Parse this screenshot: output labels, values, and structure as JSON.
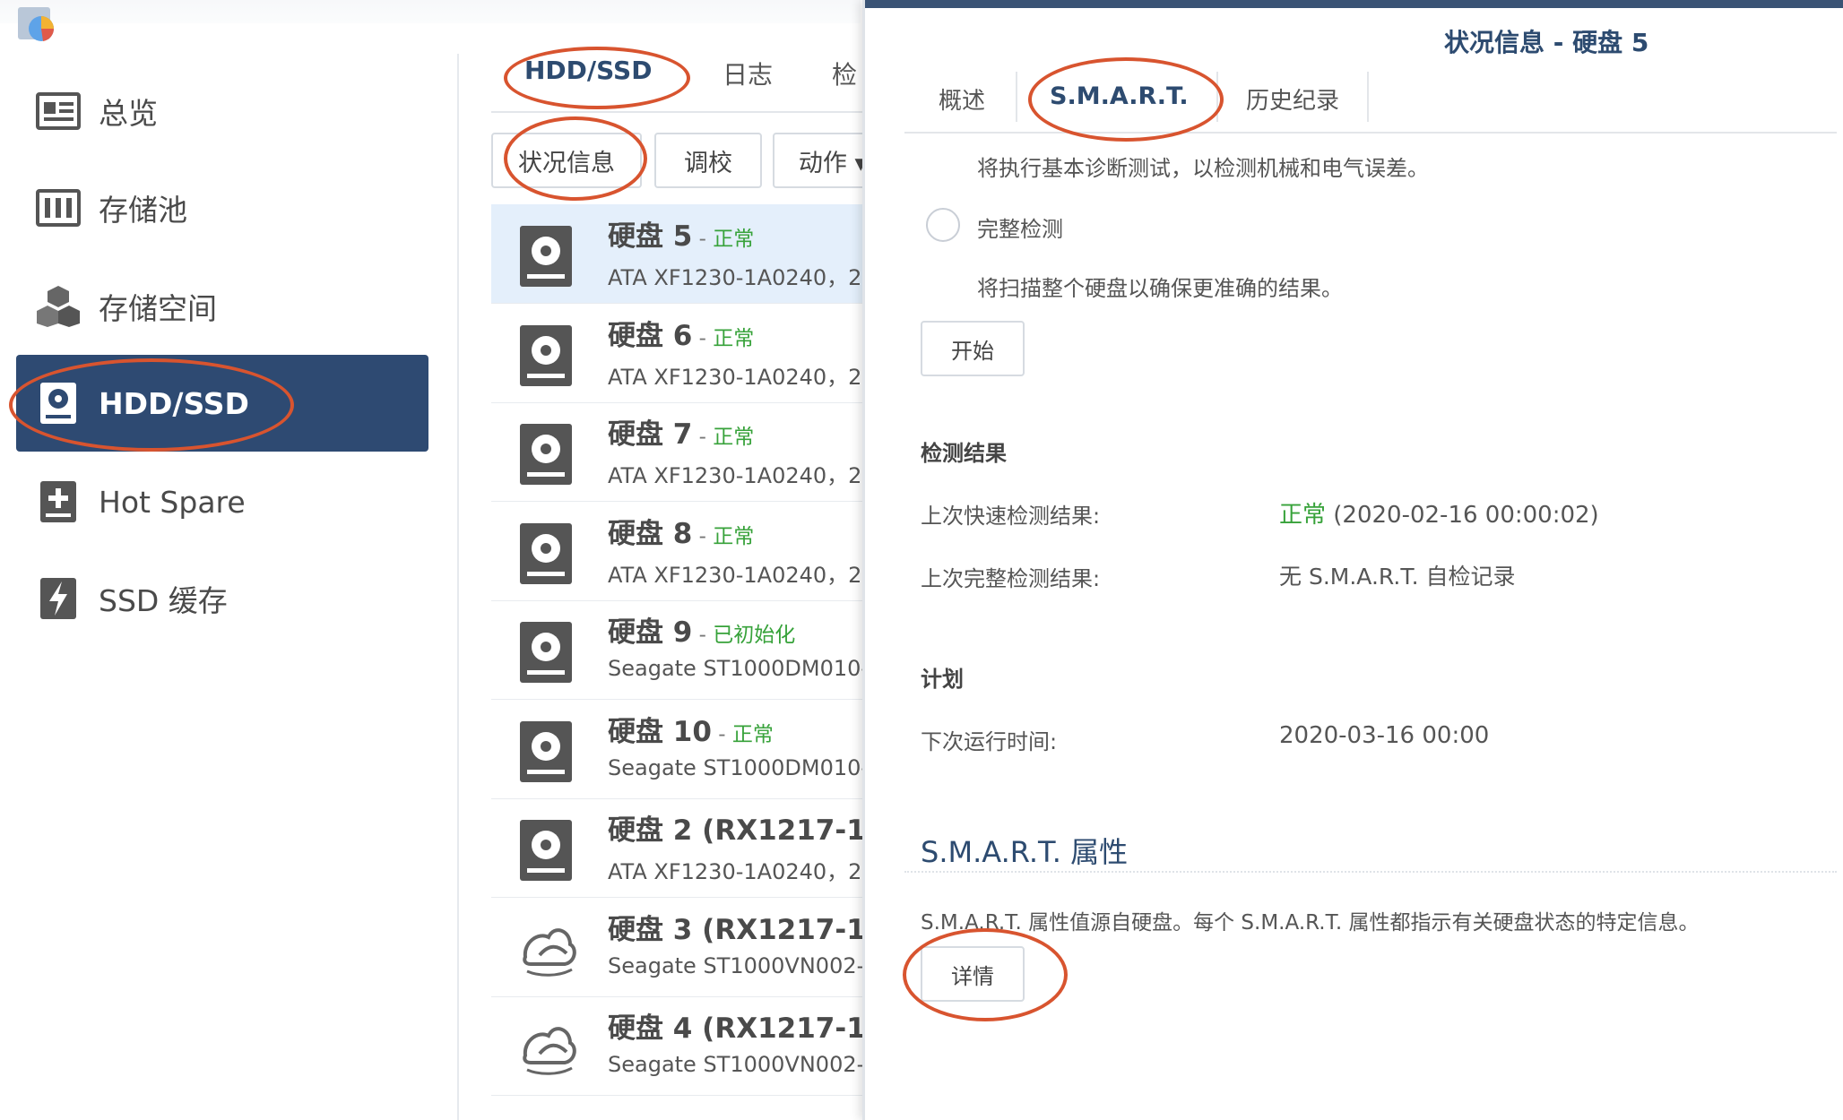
{
  "sidebar": {
    "items": [
      {
        "label": "总览",
        "icon": "overview-icon"
      },
      {
        "label": "存储池",
        "icon": "storage-pool-icon"
      },
      {
        "label": "存储空间",
        "icon": "volume-icon"
      },
      {
        "label": "HDD/SSD",
        "icon": "hdd-icon",
        "active": true
      },
      {
        "label": "Hot Spare",
        "icon": "hot-spare-icon"
      },
      {
        "label": "SSD 缓存",
        "icon": "ssd-cache-icon"
      }
    ]
  },
  "middle": {
    "tabs": [
      "HDD/SSD",
      "日志",
      "检"
    ],
    "toolbar": {
      "status_info": "状况信息",
      "calibrate": "调校",
      "action": "动作 ▾"
    },
    "disks": [
      {
        "name": "硬盘 5",
        "status": "正常",
        "model": "ATA XF1230-1A0240，2"
      },
      {
        "name": "硬盘 6",
        "status": "正常",
        "model": "ATA XF1230-1A0240，2"
      },
      {
        "name": "硬盘 7",
        "status": "正常",
        "model": "ATA XF1230-1A0240，2"
      },
      {
        "name": "硬盘 8",
        "status": "正常",
        "model": "ATA XF1230-1A0240，2"
      },
      {
        "name": "硬盘 9",
        "status": "已初始化",
        "model": "Seagate ST1000DM010-"
      },
      {
        "name": "硬盘 10",
        "status": "正常",
        "model": "Seagate ST1000DM010-"
      },
      {
        "name": "硬盘 2 (RX1217-1",
        "status": "",
        "model": "ATA XF1230-1A0240，2"
      },
      {
        "name": "硬盘 3 (RX1217-1",
        "status": "",
        "model": "Seagate ST1000VN002-"
      },
      {
        "name": "硬盘 4 (RX1217-1",
        "status": "",
        "model": "Seagate ST1000VN002-"
      }
    ]
  },
  "dialog": {
    "title": "状况信息 - 硬盘 5",
    "tabs": [
      "概述",
      "S.M.A.R.T.",
      "历史纪录"
    ],
    "quick_desc": "将执行基本诊断测试，以检测机械和电气误差。",
    "full_test_label": "完整检测",
    "full_desc": "将扫描整个硬盘以确保更准确的结果。",
    "start_button": "开始",
    "results_heading": "检测结果",
    "last_quick_label": "上次快速检测结果:",
    "last_quick_status": "正常",
    "last_quick_time": "(2020-02-16 00:00:02)",
    "last_full_label": "上次完整检测结果:",
    "last_full_value": "无 S.M.A.R.T. 自检记录",
    "schedule_heading": "计划",
    "next_run_label": "下次运行时间:",
    "next_run_value": "2020-03-16 00:00",
    "smart_attr_heading": "S.M.A.R.T. 属性",
    "smart_attr_desc": "S.M.A.R.T. 属性值源自硬盘。每个 S.M.A.R.T. 属性都指示有关硬盘状态的特定信息。",
    "details_button": "详情"
  },
  "colors": {
    "accent": "#2e4a72",
    "status_ok": "#37a23a",
    "annotation": "#d8542f"
  }
}
